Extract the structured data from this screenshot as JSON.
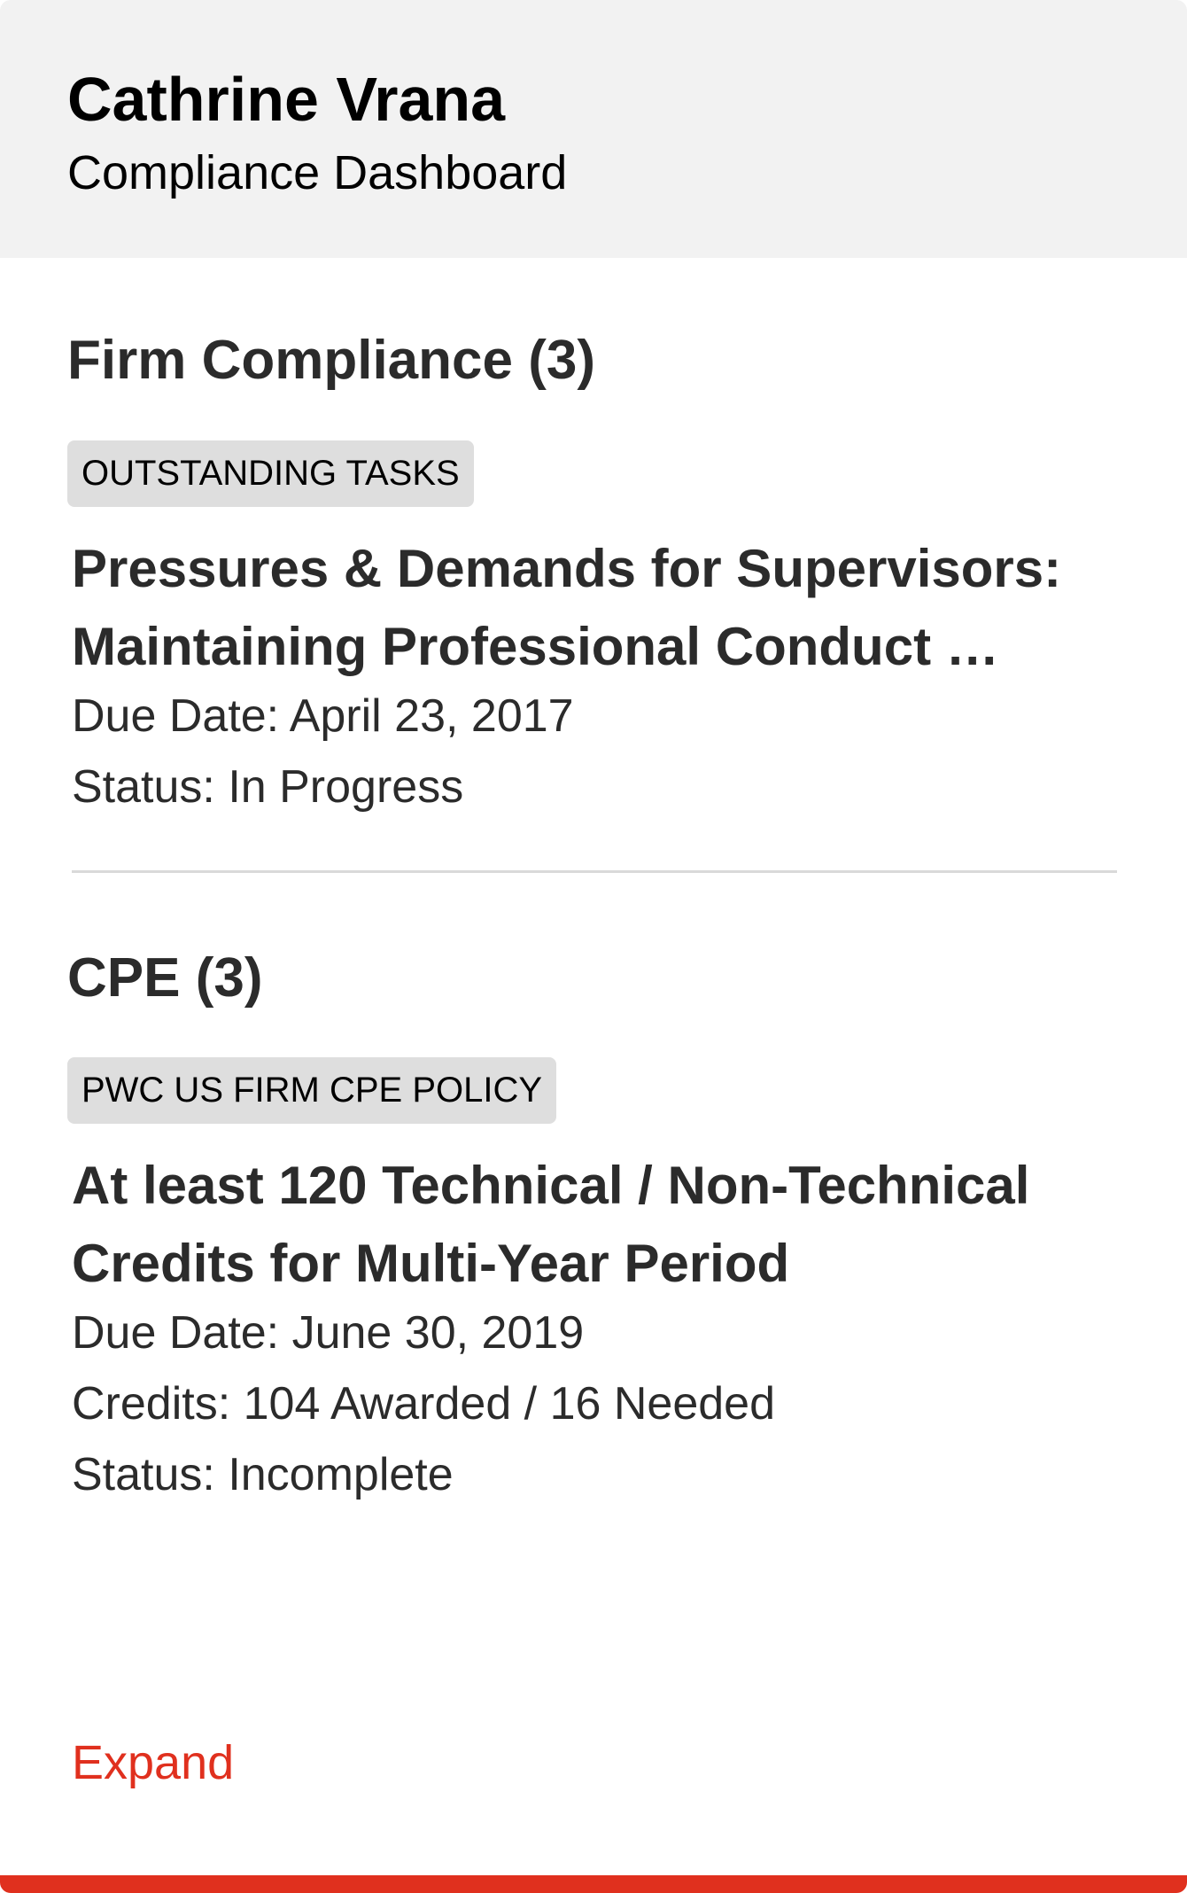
{
  "header": {
    "name": "Cathrine Vrana",
    "subtitle": "Compliance Dashboard"
  },
  "firm_compliance": {
    "title": "Firm Compliance (3)",
    "tag": "OUTSTANDING TASKS",
    "item": {
      "title_line1": "Pressures & Demands for Supervisors:",
      "title_line2": "Maintaining Professional Conduct …",
      "due_date": "Due Date: April 23, 2017",
      "status": "Status: In Progress"
    }
  },
  "cpe": {
    "title": "CPE (3)",
    "tag": "PWC US FIRM CPE POLICY",
    "item": {
      "title_line1": "At least 120 Technical / Non-Technical",
      "title_line2": "Credits for Multi-Year Period",
      "due_date": "Due Date: June 30, 2019",
      "credits": "Credits: 104 Awarded / 16 Needed",
      "status": "Status: Incomplete"
    }
  },
  "footer": {
    "expand_label": "Expand"
  },
  "colors": {
    "accent": "#e0301e",
    "header_bg": "#f2f2f2",
    "tag_bg": "#dedede",
    "divider": "#d9d9d9"
  }
}
